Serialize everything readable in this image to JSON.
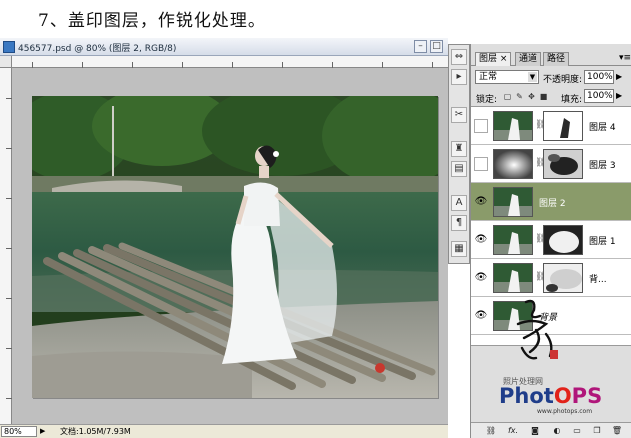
{
  "heading": "7、盖印图层，作锐化处理。",
  "document": {
    "title": "456577.psd @ 80% (图层 2, RGB/8)",
    "zoom": "80%",
    "doc_info": "文档:1.05M/7.93M"
  },
  "layers_panel": {
    "tabs": [
      "图层",
      "通道",
      "路径"
    ],
    "tab_close": "×",
    "blend_mode": "正常",
    "opacity_label": "不透明度:",
    "opacity_value": "100%",
    "lock_label": "锁定:",
    "fill_label": "填充:",
    "fill_value": "100%",
    "layers": [
      {
        "name": "图层 4",
        "visible": false,
        "has_mask": true,
        "selected": false
      },
      {
        "name": "图层 3",
        "visible": false,
        "has_mask": true,
        "selected": false
      },
      {
        "name": "图层 2",
        "visible": true,
        "has_mask": false,
        "selected": true
      },
      {
        "name": "图层 1",
        "visible": true,
        "has_mask": true,
        "selected": false
      },
      {
        "name": "背...",
        "visible": true,
        "has_mask": true,
        "selected": false
      },
      {
        "name": "背景",
        "visible": true,
        "has_mask": false,
        "selected": false
      }
    ],
    "footer_icons": [
      "link-icon",
      "fx-icon",
      "mask-icon",
      "adjustment-icon",
      "group-icon",
      "new-layer-icon",
      "trash-icon"
    ]
  },
  "tools": [
    "move-icon",
    "history-icon",
    "brush-icon",
    "stamp-icon",
    "type-icon",
    "paragraph-icon",
    "layer-comps-icon"
  ],
  "branding": {
    "cn": "照片处理网",
    "logo": "PhotoPS",
    "url": "www.photops.com"
  }
}
